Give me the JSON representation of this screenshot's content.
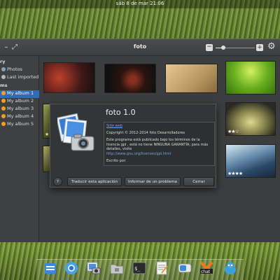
{
  "panel": {
    "clock": "sáb 8 de mar   21:06"
  },
  "window": {
    "title": "foto",
    "minimize_symbol": "–",
    "maximize_symbol": "⤢",
    "zoom_out_symbol": "−",
    "zoom_in_symbol": "+",
    "settings_icon": "gear-icon",
    "zoom_level": 0.2
  },
  "sidebar": {
    "library_header": "ry",
    "photos": "Photos",
    "last_imported": "Last imported",
    "albums_header": "ms",
    "albums": [
      "My album 1",
      "My album 2",
      "My album 3",
      "My album 4",
      "My album 5"
    ],
    "selected_album": "My album 1"
  },
  "thumbnails": [
    {
      "rating": ""
    },
    {
      "rating": ""
    },
    {
      "rating": ""
    },
    {
      "rating": ""
    },
    {
      "rating": "★"
    },
    {
      "rating": "★★☆"
    },
    {
      "rating": ""
    },
    {
      "rating": "★★★★"
    }
  ],
  "dialog": {
    "app_name": "foto 1.0",
    "website": "Sitio web",
    "copyright": "Copyright © 2012-2014 foto Desarrolladores",
    "license_text": "Este programa está publicado bajo los términos de la licencia gpl , está no tiene NINGUNA GARANTÍA; para más detalles, visite",
    "license_link": "http://www.gnu.org/licenses/gpl.html",
    "written_by": "Escrito por:",
    "help_label": "?",
    "translate_label": "Traducir esta aplicación",
    "report_label": "Informar de un problema",
    "close_label": "Cerrar"
  },
  "dock": {
    "items": [
      "files-icon",
      "browser-icon",
      "photos-icon",
      "folder-icon",
      "terminal-icon",
      "text-editor-icon",
      "settings-toggle-icon",
      "chat-icon",
      "twitter-bird-icon"
    ]
  },
  "colors": {
    "accent": "#2f6cb3",
    "link": "#6ea6e8"
  }
}
